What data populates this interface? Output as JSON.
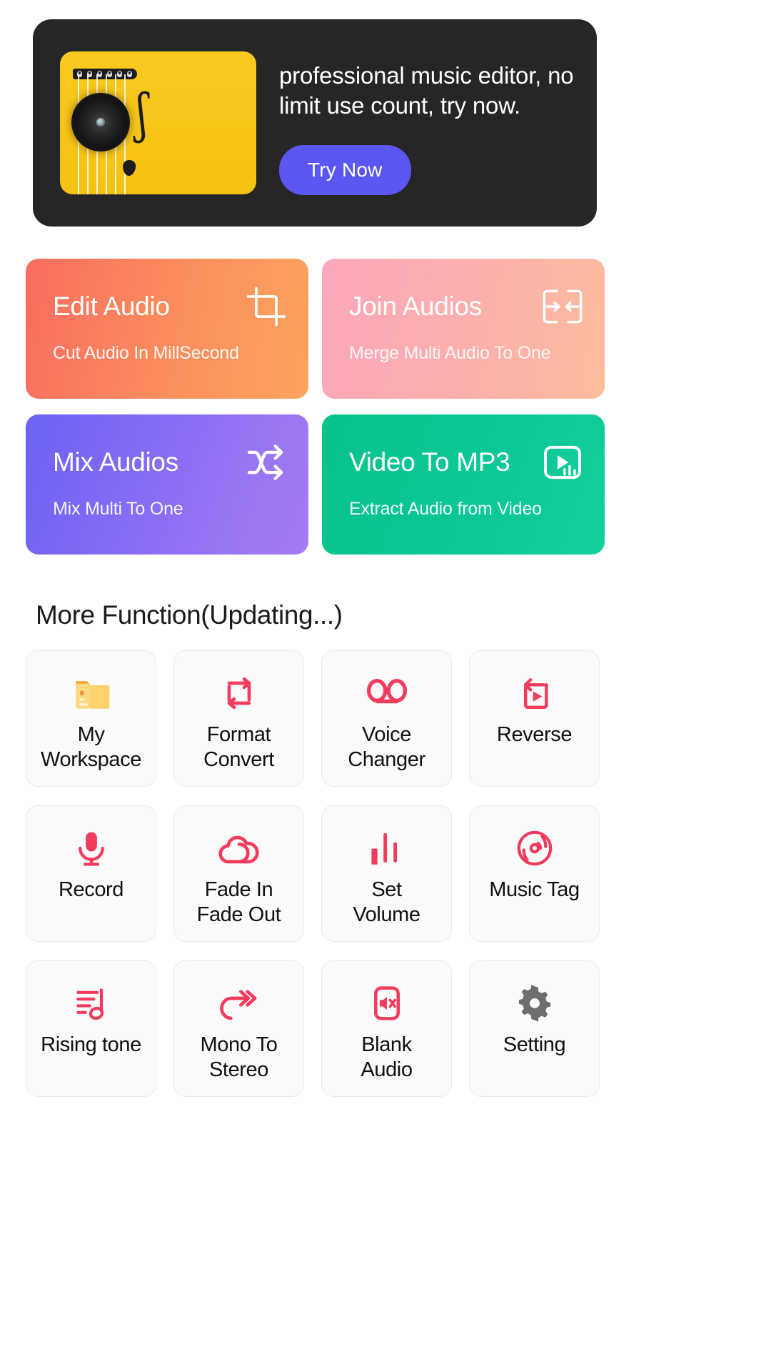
{
  "banner": {
    "text": "professional music editor, no limit use count, try now.",
    "cta_label": "Try Now",
    "bg_color": "#262626",
    "cta_color": "#5b56f0",
    "artwork_icon": "acoustic-guitar-illustration"
  },
  "features": [
    {
      "title": "Edit Audio",
      "subtitle": "Cut Audio In MillSecond",
      "icon": "crop-icon",
      "gradient_from": "#f96e5f",
      "gradient_to": "#fca45e"
    },
    {
      "title": "Join Audios",
      "subtitle": "Merge Multi Audio To One",
      "icon": "merge-arrows-icon",
      "gradient_from": "#fba7bb",
      "gradient_to": "#fdbc9b"
    },
    {
      "title": "Mix Audios",
      "subtitle": "Mix Multi To One",
      "icon": "shuffle-icon",
      "gradient_from": "#6b62f5",
      "gradient_to": "#a57cf2"
    },
    {
      "title": "Video To MP3",
      "subtitle": "Extract Audio from Video",
      "icon": "video-to-audio-icon",
      "gradient_from": "#07c28a",
      "gradient_to": "#14cf9e"
    }
  ],
  "more": {
    "section_title": "More Function(Updating...)",
    "accent_color": "#f23b5d",
    "items": [
      {
        "label": "My\nWorkspace",
        "icon": "folder-icon"
      },
      {
        "label": "Format\nConvert",
        "icon": "loop-convert-icon"
      },
      {
        "label": "Voice\nChanger",
        "icon": "voicemail-icon"
      },
      {
        "label": "Reverse",
        "icon": "reverse-play-icon"
      },
      {
        "label": "Record",
        "icon": "microphone-icon"
      },
      {
        "label": "Fade In\nFade Out",
        "icon": "cloud-fade-icon"
      },
      {
        "label": "Set\nVolume",
        "icon": "equalizer-bars-icon"
      },
      {
        "label": "Music Tag",
        "icon": "vinyl-disc-icon"
      },
      {
        "label": "Rising tone",
        "icon": "rising-note-icon"
      },
      {
        "label": "Mono To\nStereo",
        "icon": "double-arrow-icon"
      },
      {
        "label": "Blank\nAudio",
        "icon": "mute-speaker-icon"
      },
      {
        "label": "Setting",
        "icon": "gear-icon"
      }
    ]
  }
}
